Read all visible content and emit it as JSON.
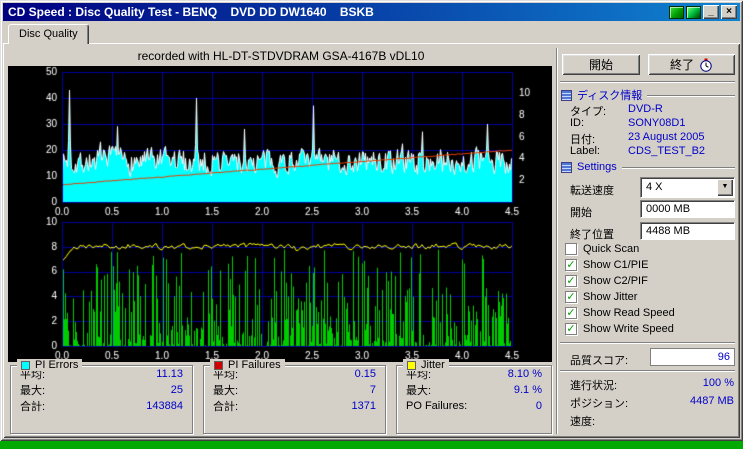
{
  "window": {
    "title": "CD Speed : Disc Quality Test - BENQ    DVD DD DW1640    BSKB"
  },
  "icons": {
    "minimize": "_",
    "close": "×",
    "dropdown": "▼",
    "check": "✓"
  },
  "tab": {
    "label": "Disc Quality"
  },
  "recorded_with": "recorded with HL-DT-STDVDRAM GSA-4167B vDL10",
  "buttons": {
    "start": "開始",
    "exit": "終了"
  },
  "disc_info": {
    "header": "ディスク情報",
    "rows": [
      {
        "label": "タイプ:",
        "value": "DVD-R"
      },
      {
        "label": "ID:",
        "value": "SONY08D1"
      },
      {
        "label": "日付:",
        "value": "23 August 2005"
      },
      {
        "label": "Label:",
        "value": "CDS_TEST_B2"
      }
    ]
  },
  "settings": {
    "header": "Settings",
    "transfer_speed": {
      "label": "転送速度",
      "value": "4 X"
    },
    "start": {
      "label": "開始",
      "value": "0000 MB"
    },
    "end": {
      "label": "終了位置",
      "value": "4488 MB"
    },
    "checkboxes": [
      {
        "label": "Quick Scan",
        "checked": false
      },
      {
        "label": "Show C1/PIE",
        "checked": true
      },
      {
        "label": "Show C2/PIF",
        "checked": true
      },
      {
        "label": "Show Jitter",
        "checked": true
      },
      {
        "label": "Show Read Speed",
        "checked": true
      },
      {
        "label": "Show Write Speed",
        "checked": true
      }
    ]
  },
  "score": {
    "label": "品質スコア:",
    "value": "96"
  },
  "status": {
    "rows": [
      {
        "label": "進行状況:",
        "value": "100 %"
      },
      {
        "label": "ポジション:",
        "value": "4487 MB"
      },
      {
        "label": "速度:",
        "value": ""
      }
    ]
  },
  "stats_panels": [
    {
      "title": "PI Errors",
      "color": "#00FFFF",
      "rows": [
        {
          "label": "平均:",
          "value": "11.13"
        },
        {
          "label": "最大:",
          "value": "25"
        },
        {
          "label": "合計:",
          "value": "143884"
        }
      ]
    },
    {
      "title": "PI Failures",
      "color": "#D00000",
      "rows": [
        {
          "label": "平均:",
          "value": "0.15"
        },
        {
          "label": "最大:",
          "value": "7"
        },
        {
          "label": "合計:",
          "value": "1371"
        }
      ]
    },
    {
      "title": "Jitter",
      "color": "#FFFF00",
      "rows": [
        {
          "label": "平均:",
          "value": "8.10 %"
        },
        {
          "label": "最大:",
          "value": "9.1 %"
        },
        {
          "label": "PO Failures:",
          "value": "0"
        }
      ]
    }
  ],
  "chart_data": [
    {
      "name": "pi-errors-graph",
      "type": "area",
      "x_min": 0,
      "x_max": 4.5,
      "x_tick_step": 0.5,
      "x_tick_labels": [
        "0.0",
        "0.5",
        "1.0",
        "1.5",
        "2.0",
        "2.5",
        "3.0",
        "3.5",
        "4.0",
        "4.5"
      ],
      "y_left": {
        "min": 0,
        "max": 50,
        "ticks": [
          0,
          10,
          20,
          30,
          40,
          50
        ],
        "grid": [
          10,
          20,
          30,
          40
        ]
      },
      "y_right": {
        "min": 0,
        "max": 12,
        "ticks": [
          2,
          4,
          6,
          8,
          10
        ]
      },
      "bg_color": "#000000",
      "grid_color": "#0000A0",
      "border_color": "#0000A0",
      "text_color": "#FFFFFF",
      "series": [
        {
          "name": "pi-errors-pie",
          "legend": "PI Errors (C1/PIE)",
          "style": "noise-area",
          "color": "#00FFFF",
          "outline_color": "#FFFFFF",
          "seed": 7,
          "base_min": 9,
          "base_max": 22,
          "spike_chance": 0.015,
          "spike_extra": 9,
          "peaks": [
            [
              0.07,
              43
            ],
            [
              0.55,
              29
            ],
            [
              1.34,
              40
            ],
            [
              1.82,
              28
            ],
            [
              2.51,
              37
            ],
            [
              3.6,
              27
            ],
            [
              4.25,
              30
            ]
          ],
          "average": 11.13,
          "maximum": 25,
          "total": 143884
        },
        {
          "name": "write-speed",
          "legend": "Write Speed",
          "style": "trend-line",
          "color": "#E64000",
          "axis": "right",
          "points": [
            [
              0,
              1.6
            ],
            [
              4.5,
              4.8
            ]
          ],
          "wobble": 0.07,
          "seed": 3
        }
      ]
    },
    {
      "name": "pif-jitter-graph",
      "type": "bars-line",
      "x_min": 0,
      "x_max": 4.5,
      "x_tick_step": 0.5,
      "x_tick_labels": [
        "0.0",
        "0.5",
        "1.0",
        "1.5",
        "2.0",
        "2.5",
        "3.0",
        "3.5",
        "4.0",
        "4.5"
      ],
      "y_left": {
        "min": 0,
        "max": 10,
        "ticks": [
          0,
          2,
          4,
          6,
          8,
          10
        ],
        "grid": [
          2,
          4,
          6,
          8
        ]
      },
      "bg_color": "#000000",
      "grid_color": "#0000A0",
      "border_color": "#0000A0",
      "text_color": "#FFFFFF",
      "series": [
        {
          "name": "pi-failures-pif",
          "legend": "PI Failures (C2/PIF)",
          "style": "noise-bars",
          "color": "#00CC00",
          "seed": 13,
          "density": 0.82,
          "power": 2.2,
          "max_value": 7.8,
          "average": 0.15,
          "maximum": 7,
          "total": 1371
        },
        {
          "name": "jitter",
          "legend": "Jitter",
          "style": "noise-line",
          "color": "#FFFF00",
          "seed": 21,
          "base": 8.05,
          "variance": 0.7,
          "dip_chance": 0.02,
          "dip_depth": 1.0,
          "average_pct": 8.1,
          "maximum_pct": 9.1
        }
      ]
    }
  ]
}
